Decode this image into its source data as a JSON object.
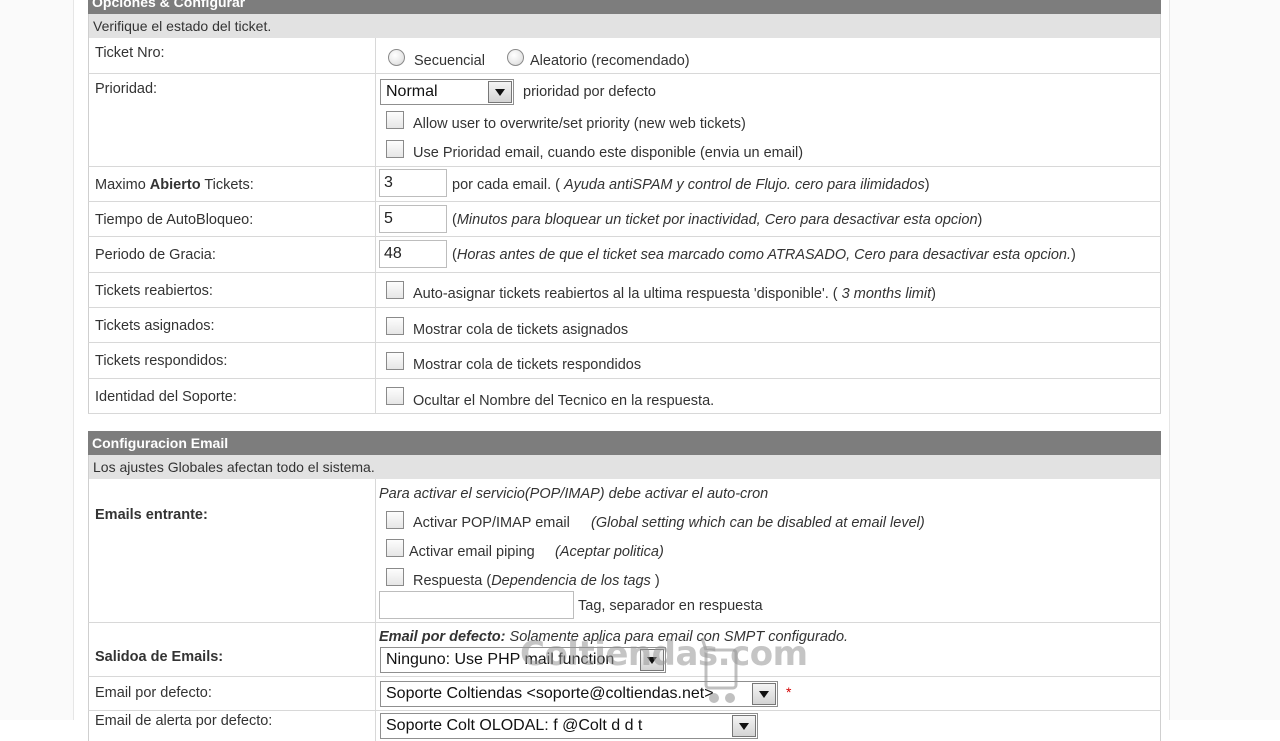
{
  "section1": {
    "title": "Opciones & Configurar",
    "subtitle": "Verifique el estado del ticket."
  },
  "rows": {
    "ticket_nro": {
      "label": "Ticket Nro:",
      "opt1": "Secuencial",
      "opt2": "Aleatorio (recomendado)"
    },
    "prioridad": {
      "label": "Prioridad:",
      "select_value": "Normal",
      "select_note": "prioridad por defecto",
      "check1": "Allow user to overwrite/set priority (new web tickets)",
      "check2": "Use Prioridad email, cuando este disponible (envia un email)"
    },
    "max_abierto": {
      "label_pre": "Maximo ",
      "label_bold": "Abierto",
      "label_post": " Tickets:",
      "value": "3",
      "note_pre": "por cada email. ( ",
      "note_it": "Ayuda antiSPAM y control de Flujo. cero para ilimidados",
      "note_post": ")"
    },
    "autobloqueo": {
      "label": "Tiempo de AutoBloqueo:",
      "value": "5",
      "note_pre": "(",
      "note_it": "Minutos para bloquear un ticket por inactividad, Cero para desactivar esta opcion",
      "note_post": ")"
    },
    "gracia": {
      "label": "Periodo de Gracia:",
      "value": "48",
      "note_pre": "(",
      "note_it": "Horas antes de que el ticket sea marcado como ATRASADO, Cero para desactivar esta opcion.",
      "note_post": ")"
    },
    "reabiertos": {
      "label": "Tickets reabiertos:",
      "text_pre": "Auto-asignar tickets reabiertos al la ultima respuesta 'disponible'. ( ",
      "text_it": "3 months limit",
      "text_post": ")"
    },
    "asignados": {
      "label": "Tickets asignados:",
      "text": "Mostrar cola de tickets asignados"
    },
    "respondidos": {
      "label": "Tickets respondidos:",
      "text": "Mostrar cola de tickets respondidos"
    },
    "identidad": {
      "label": "Identidad del Soporte:",
      "text": "Ocultar el Nombre del Tecnico en la respuesta."
    }
  },
  "section2": {
    "title": "Configuracion Email",
    "subtitle": "Los ajustes Globales afectan todo el sistema."
  },
  "email": {
    "entrante": {
      "label": "Emails entrante:",
      "note": "Para activar el servicio(POP/IMAP) debe activar el auto-cron",
      "pop_label": "Activar POP/IMAP email",
      "pop_note": "(Global setting which can be disabled at email level)",
      "piping_label": "Activar email piping",
      "piping_note": "(Aceptar politica)",
      "respuesta_pre": "Respuesta (",
      "respuesta_it": "Dependencia de los tags",
      "respuesta_post": " )",
      "tag_placeholder": "",
      "tag_note": "Tag, separador en respuesta"
    },
    "salida": {
      "label": "Salidoa de Emails:",
      "note_bold": "Email por defecto:",
      "note_rest": " Solamente aplica para email con SMPT configurado.",
      "select_value": "Ninguno: Use PHP mail function"
    },
    "por_defecto": {
      "label": "Email por defecto:",
      "select_value": "Soporte Coltiendas <soporte@coltiendas.net>",
      "required": "*"
    },
    "alerta": {
      "label": "Email de alerta por defecto:",
      "select_value": "Soporte Colt OLODAL: f @Colt d d t"
    }
  },
  "watermark": {
    "text": "Coltiendas.com"
  }
}
